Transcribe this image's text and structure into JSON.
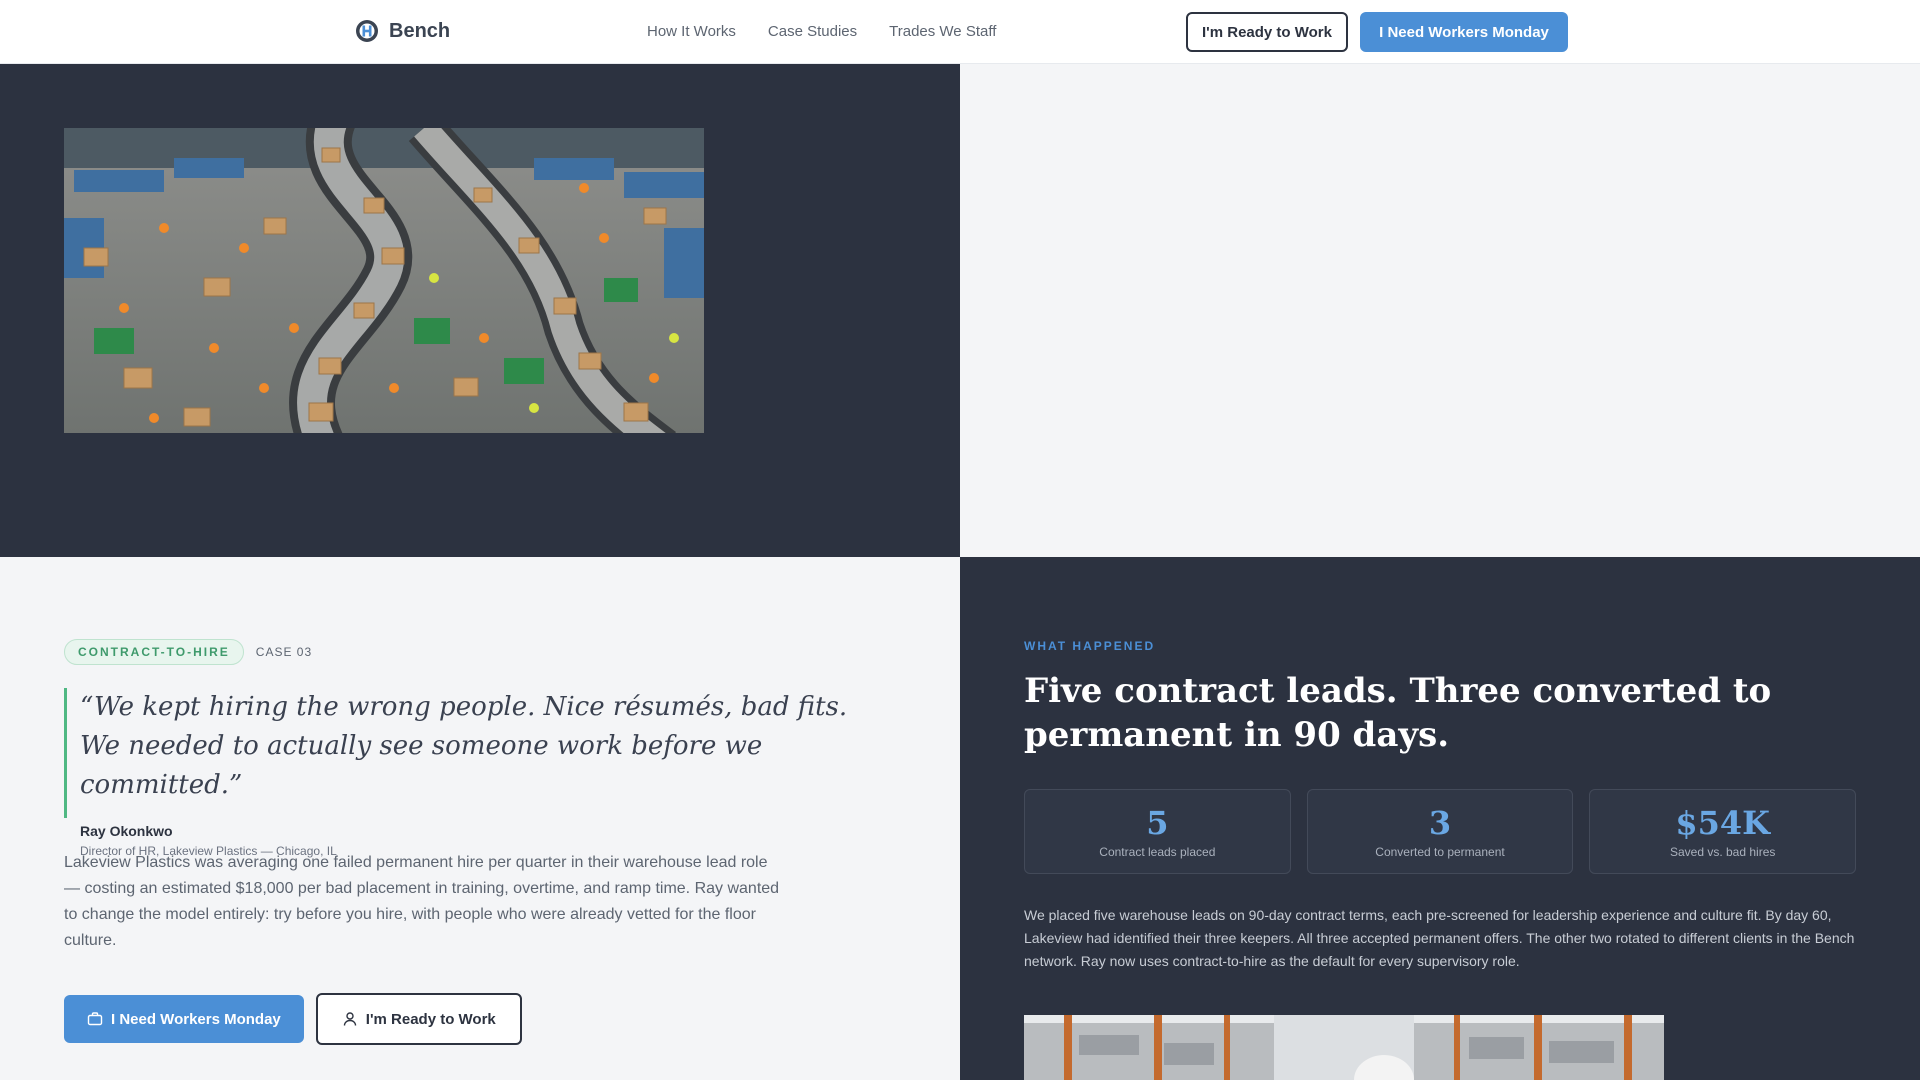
{
  "nav": {
    "brand": "Bench",
    "links": [
      "How It Works",
      "Case Studies",
      "Trades We Staff"
    ],
    "ready_button": "I'm Ready to Work",
    "workers_button": "I Need Workers Monday"
  },
  "case": {
    "tag": "CONTRACT-TO-HIRE",
    "case_number": "CASE 03",
    "quote": "“We kept hiring the wrong people. Nice résumés, bad fits. We needed to actually see someone work before we committed.”",
    "person_name": "Ray Okonkwo",
    "person_role": "Director of HR, Lakeview Plastics — Chicago, IL",
    "body": "Lakeview Plastics was averaging one failed permanent hire per quarter in their warehouse lead role — costing an estimated $18,000 per bad placement in training, overtime, and ramp time. Ray wanted to change the model entirely: try before you hire, with people who were already vetted for the floor culture.",
    "cta_primary": "I Need Workers Monday",
    "cta_secondary": "I'm Ready to Work"
  },
  "outcome": {
    "eyebrow": "WHAT HAPPENED",
    "headline": "Five contract leads. Three converted to permanent in 90 days.",
    "stats": [
      {
        "value": "5",
        "label": "Contract leads placed"
      },
      {
        "value": "3",
        "label": "Converted to permanent"
      },
      {
        "value": "$54K",
        "label": "Saved vs. bad hires"
      }
    ],
    "body": "We placed five warehouse leads on 90-day contract terms, each pre-screened for leadership experience and culture fit. By day 60, Lakeview had identified their three keepers. All three accepted permanent offers. The other two rotated to different clients in the Bench network. Ray now uses contract-to-hire as the default for every supervisory role."
  },
  "colors": {
    "dark_panel": "#2c3240",
    "light_panel": "#f4f5f7",
    "accent_blue": "#4b8fd6",
    "accent_green": "#4fb883"
  }
}
